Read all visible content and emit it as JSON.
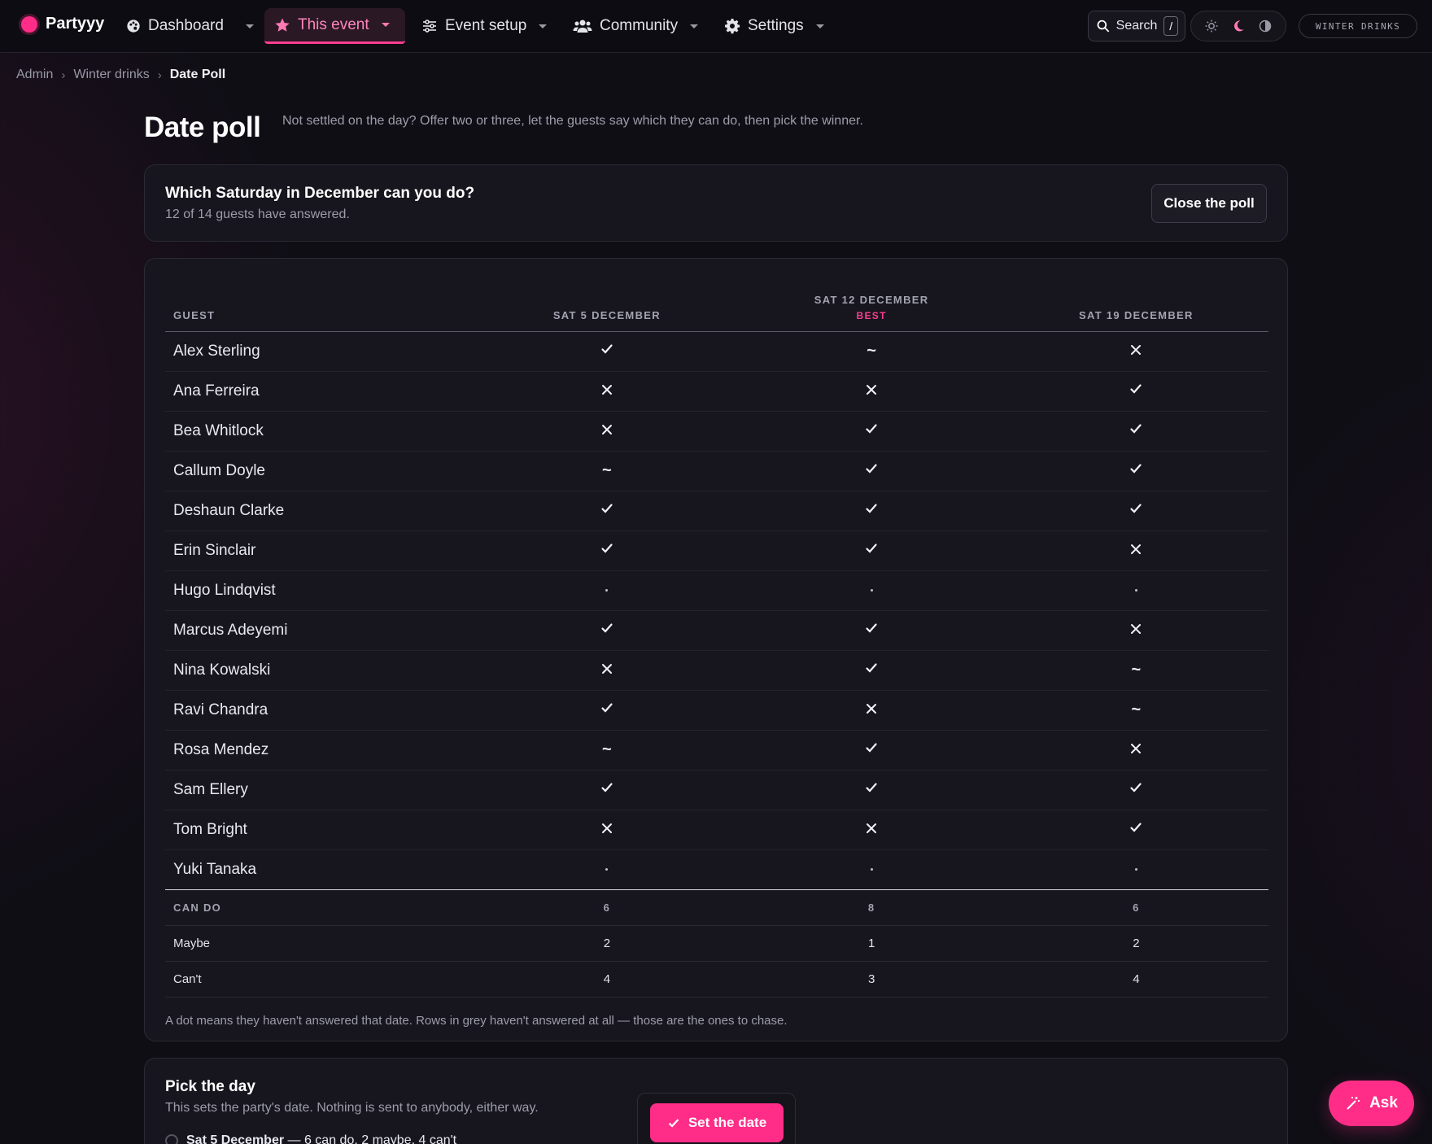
{
  "brand": {
    "name": "Partyyy",
    "accent": "#ff2d87"
  },
  "nav": [
    {
      "label": "Dashboard",
      "icon": "palette-icon",
      "active": false
    },
    {
      "label": "This event",
      "icon": "star-icon",
      "active": true
    },
    {
      "label": "Event setup",
      "icon": "sliders-icon",
      "active": false
    },
    {
      "label": "Community",
      "icon": "users-icon",
      "active": false
    },
    {
      "label": "Settings",
      "icon": "gear-icon",
      "active": false
    }
  ],
  "search": {
    "label": "Search",
    "shortcut": "/"
  },
  "theme_icons": [
    "sun-icon",
    "moon-icon",
    "contrast-icon"
  ],
  "event_chip": "WINTER DRINKS",
  "breadcrumb": {
    "items": [
      "Admin",
      "Winter drinks"
    ],
    "current": "Date Poll"
  },
  "header": {
    "title": "Date poll",
    "subtitle": "Not settled on the day? Offer two or three, let the guests say which they can do, then pick the winner."
  },
  "poll": {
    "question": "Which Saturday in December can you do?",
    "answered": "12 of 14 guests have answered.",
    "close_label": "Close the poll"
  },
  "table": {
    "guest_header": "GUEST",
    "dates": [
      {
        "label": "SAT 5 DECEMBER",
        "tag": ""
      },
      {
        "label": "SAT 12 DECEMBER",
        "tag": "BEST"
      },
      {
        "label": "SAT 19 DECEMBER",
        "tag": ""
      }
    ],
    "rows": [
      {
        "name": "Alex Sterling",
        "marks": [
          "yes",
          "maybe",
          "no"
        ]
      },
      {
        "name": "Ana Ferreira",
        "marks": [
          "no",
          "no",
          "yes"
        ]
      },
      {
        "name": "Bea Whitlock",
        "marks": [
          "no",
          "yes",
          "yes"
        ]
      },
      {
        "name": "Callum Doyle",
        "marks": [
          "maybe",
          "yes",
          "yes"
        ]
      },
      {
        "name": "Deshaun Clarke",
        "marks": [
          "yes",
          "yes",
          "yes"
        ]
      },
      {
        "name": "Erin Sinclair",
        "marks": [
          "yes",
          "yes",
          "no"
        ]
      },
      {
        "name": "Hugo Lindqvist",
        "marks": [
          "none",
          "none",
          "none"
        ]
      },
      {
        "name": "Marcus Adeyemi",
        "marks": [
          "yes",
          "yes",
          "no"
        ]
      },
      {
        "name": "Nina Kowalski",
        "marks": [
          "no",
          "yes",
          "maybe"
        ]
      },
      {
        "name": "Ravi Chandra",
        "marks": [
          "yes",
          "no",
          "maybe"
        ]
      },
      {
        "name": "Rosa Mendez",
        "marks": [
          "maybe",
          "yes",
          "no"
        ]
      },
      {
        "name": "Sam Ellery",
        "marks": [
          "yes",
          "yes",
          "yes"
        ]
      },
      {
        "name": "Tom Bright",
        "marks": [
          "no",
          "no",
          "yes"
        ]
      },
      {
        "name": "Yuki Tanaka",
        "marks": [
          "none",
          "none",
          "none"
        ]
      }
    ],
    "totals": [
      {
        "label": "CAN DO",
        "values": [
          "6",
          "8",
          "6"
        ]
      },
      {
        "label": "Maybe",
        "values": [
          "2",
          "1",
          "2"
        ]
      },
      {
        "label": "Can't",
        "values": [
          "4",
          "3",
          "4"
        ]
      }
    ],
    "footnote": "A dot means they haven't answered that date. Rows in grey haven't answered at all — those are the ones to chase."
  },
  "pick": {
    "title": "Pick the day",
    "subtitle": "This sets the party's date. Nothing is sent to anybody, either way.",
    "option_date": "Sat 5 December",
    "option_detail": " — 6 can do, 2 maybe, 4 can't",
    "set_label": "Set the date"
  },
  "ask_label": "Ask"
}
